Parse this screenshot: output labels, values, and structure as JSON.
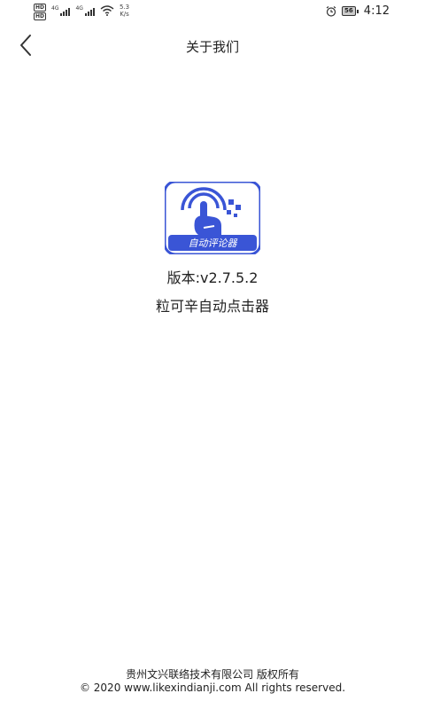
{
  "status_bar": {
    "network_type": "4G",
    "speed_value": "5.3",
    "speed_unit": "K/s",
    "battery": "56",
    "time": "4:12"
  },
  "header": {
    "title": "关于我们",
    "back_icon": "chevron-left-icon"
  },
  "logo": {
    "icon": "touch-hand-icon",
    "banner_text": "自动评论器",
    "colors": {
      "primary": "#3a55d6",
      "background": "#ffffff"
    }
  },
  "info": {
    "version": "版本:v2.7.5.2",
    "app_name": "粒可辛自动点击器"
  },
  "footer": {
    "company": "贵州文兴联络技术有限公司 版权所有",
    "copyright": "© 2020 www.likexindianji.com All rights reserved."
  }
}
